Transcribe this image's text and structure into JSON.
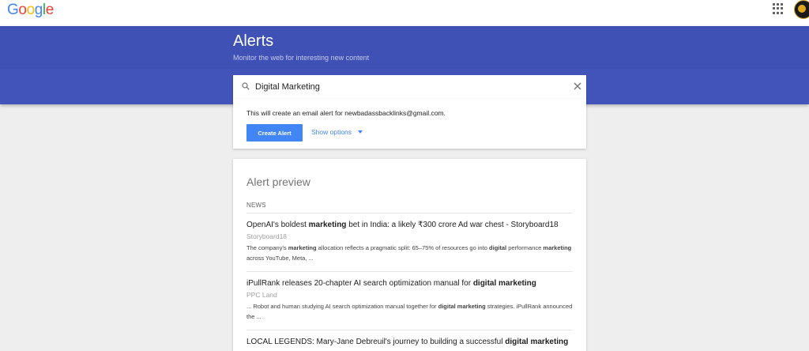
{
  "header": {
    "logo_letters": [
      {
        "ch": "G",
        "color": "#4285f4"
      },
      {
        "ch": "o",
        "color": "#ea4335"
      },
      {
        "ch": "o",
        "color": "#fbbc05"
      },
      {
        "ch": "g",
        "color": "#4285f4"
      },
      {
        "ch": "l",
        "color": "#34a853"
      },
      {
        "ch": "e",
        "color": "#ea4335"
      }
    ],
    "apps_icon": "apps-grid-icon",
    "avatar_icon": "account-avatar-icon"
  },
  "banner": {
    "title": "Alerts",
    "subtitle": "Monitor the web for interesting new content",
    "color": "#3f51b5"
  },
  "search": {
    "value": "Digital Marketing",
    "search_icon": "search-icon",
    "clear_icon": "close-icon"
  },
  "create": {
    "email_note": "This will create an email alert for newbadassbacklinks@gmail.com.",
    "create_button": "Create Alert",
    "show_options": "Show options",
    "accent": "#4285f4"
  },
  "preview": {
    "title": "Alert preview",
    "section": "NEWS",
    "items": [
      {
        "title": [
          {
            "t": "OpenAI's boldest ",
            "b": false
          },
          {
            "t": "marketing",
            "b": true
          },
          {
            "t": " bet in India: a likely ₹300 crore Ad war chest - Storyboard18",
            "b": false
          }
        ],
        "source": "Storyboard18",
        "snippet": [
          {
            "t": "The company's ",
            "b": false
          },
          {
            "t": "marketing",
            "b": true
          },
          {
            "t": " allocation reflects a pragmatic split: 65–75% of resources go into ",
            "b": false
          },
          {
            "t": "digital",
            "b": true
          },
          {
            "t": " performance ",
            "b": false
          },
          {
            "t": "marketing",
            "b": true
          },
          {
            "t": " across YouTube, Meta, ...",
            "b": false
          }
        ]
      },
      {
        "title": [
          {
            "t": "iPullRank releases 20-chapter AI search optimization manual for ",
            "b": false
          },
          {
            "t": "digital marketing",
            "b": true
          }
        ],
        "source": "PPC Land",
        "snippet": [
          {
            "t": "... Robot and human studying AI search optimization manual together for ",
            "b": false
          },
          {
            "t": "digital marketing",
            "b": true
          },
          {
            "t": " strategies. iPullRank announced the ...",
            "b": false
          }
        ]
      },
      {
        "title": [
          {
            "t": "LOCAL LEGENDS: Mary-Jane Debreuil's journey to building a successful ",
            "b": false
          },
          {
            "t": "digital marketing",
            "b": true
          }
        ],
        "source": "",
        "snippet": []
      }
    ]
  }
}
